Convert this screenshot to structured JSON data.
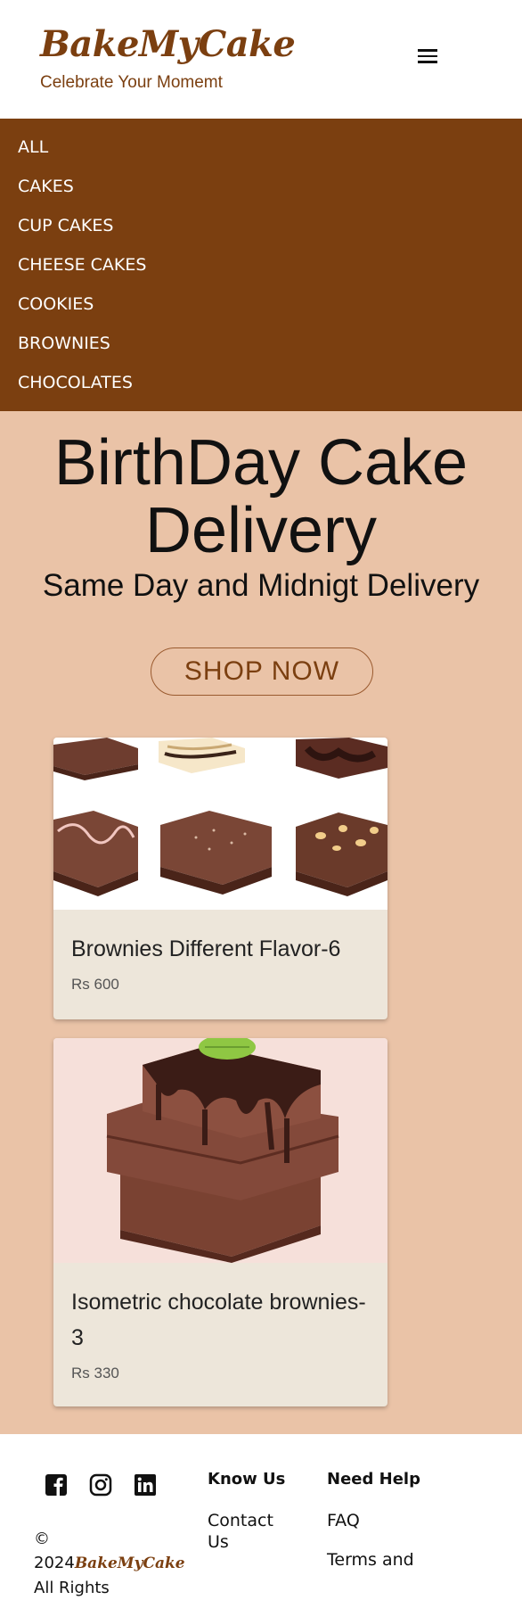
{
  "brand": {
    "logo": "BakeMyCake",
    "tagline": "Celebrate Your Momemt"
  },
  "header": {
    "menu_icon": "hamburger-menu-icon"
  },
  "nav": {
    "items": [
      {
        "label": "ALL"
      },
      {
        "label": "CAKES"
      },
      {
        "label": "CUP CAKES"
      },
      {
        "label": "CHEESE CAKES"
      },
      {
        "label": "COOKIES"
      },
      {
        "label": "BROWNIES"
      },
      {
        "label": "CHOCOLATES"
      }
    ]
  },
  "hero": {
    "title": "BirthDay Cake Delivery",
    "subtitle": "Same Day and Midnigt Delivery",
    "button": "SHOP NOW"
  },
  "products": [
    {
      "title": "Brownies Different Flavor-6",
      "price": "Rs 600"
    },
    {
      "title": "Isometric chocolate brownies-3",
      "price": "Rs 330"
    }
  ],
  "footer": {
    "social": [
      "facebook-icon",
      "instagram-icon",
      "linkedin-icon"
    ],
    "copyright_prefix": "© 2024",
    "copyright_logo": "BakeMyCake",
    "copyright_suffix": "All Rights",
    "know_us": {
      "heading": "Know Us",
      "links": [
        "Contact Us"
      ]
    },
    "need_help": {
      "heading": "Need Help",
      "links": [
        "FAQ",
        "Terms and"
      ]
    }
  },
  "colors": {
    "brand": "#7b3f10",
    "hero_bg": "#eac3a7",
    "card_bg": "#ede6da"
  }
}
